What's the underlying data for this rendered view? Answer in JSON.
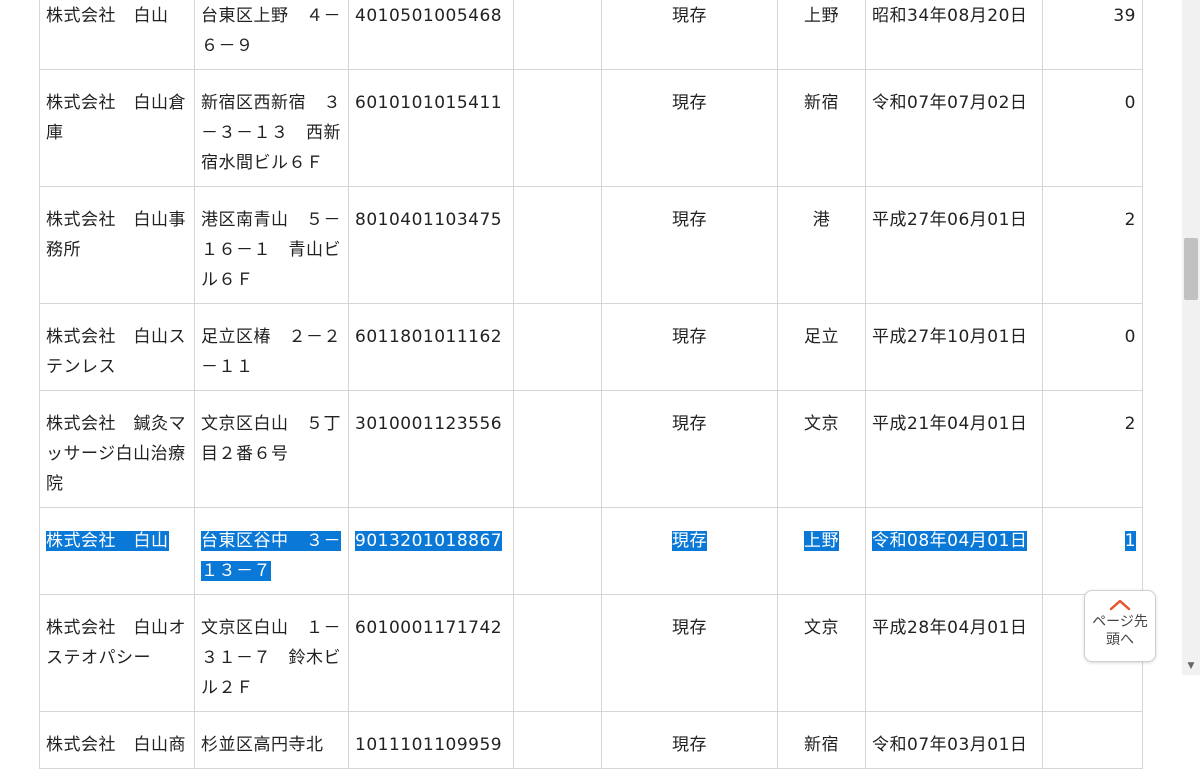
{
  "rows": [
    {
      "name": "株式会社　白山",
      "address": "台東区上野　４－６－９",
      "corp_no": "4010501005468",
      "status": "現存",
      "office": "上野",
      "date": "昭和34年08月20日",
      "count": "39",
      "selected": false
    },
    {
      "name": "株式会社　白山倉庫",
      "address": "新宿区西新宿　３－３－１３　西新宿水間ビル６Ｆ",
      "corp_no": "6010101015411",
      "status": "現存",
      "office": "新宿",
      "date": "令和07年07月02日",
      "count": "0",
      "selected": false
    },
    {
      "name": "株式会社　白山事務所",
      "address": "港区南青山　５－１６－１　青山ビル６Ｆ",
      "corp_no": "8010401103475",
      "status": "現存",
      "office": "港",
      "date": "平成27年06月01日",
      "count": "2",
      "selected": false
    },
    {
      "name": "株式会社　白山ステンレス",
      "address": "足立区椿　２－２－１１",
      "corp_no": "6011801011162",
      "status": "現存",
      "office": "足立",
      "date": "平成27年10月01日",
      "count": "0",
      "selected": false
    },
    {
      "name": "株式会社　鍼灸マッサージ白山治療院",
      "address": "文京区白山　５丁目２番６号",
      "corp_no": "3010001123556",
      "status": "現存",
      "office": "文京",
      "date": "平成21年04月01日",
      "count": "2",
      "selected": false
    },
    {
      "name": "株式会社　白山",
      "address": "台東区谷中　３－１３－７",
      "corp_no": "9013201018867",
      "status": "現存",
      "office": "上野",
      "date": "令和08年04月01日",
      "count": "1",
      "selected": true
    },
    {
      "name": "株式会社　白山オステオパシー",
      "address": "文京区白山　１－３１－７　鈴木ビル２Ｆ",
      "corp_no": "6010001171742",
      "status": "現存",
      "office": "文京",
      "date": "平成28年04月01日",
      "count": "0",
      "selected": false
    },
    {
      "name": "株式会社　白山商",
      "address": "杉並区高円寺北",
      "corp_no": "1011101109959",
      "status": "現存",
      "office": "新宿",
      "date": "令和07年03月01日",
      "count": "",
      "selected": false
    }
  ],
  "back_to_top": {
    "label": "ページ先頭へ",
    "icon": "chevron-up-icon",
    "icon_color": "#e8542a"
  },
  "colors": {
    "selection": "#0a78d7",
    "grid": "#d6d6d6"
  }
}
